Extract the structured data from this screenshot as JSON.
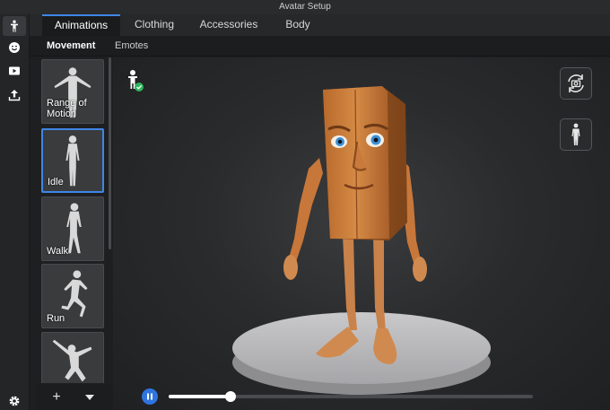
{
  "window": {
    "title": "Avatar Setup"
  },
  "rail": {
    "items": [
      {
        "icon": "person-icon",
        "active": true
      },
      {
        "icon": "smiley-icon",
        "active": false
      },
      {
        "icon": "video-icon",
        "active": false
      },
      {
        "icon": "upload-icon",
        "active": false
      }
    ],
    "settings_icon": "gear-icon"
  },
  "tabs": [
    {
      "label": "Animations",
      "active": true
    },
    {
      "label": "Clothing",
      "active": false
    },
    {
      "label": "Accessories",
      "active": false
    },
    {
      "label": "Body",
      "active": false
    }
  ],
  "subtabs": [
    {
      "label": "Movement",
      "active": true
    },
    {
      "label": "Emotes",
      "active": false
    }
  ],
  "animations": [
    {
      "label": "Range of Motion",
      "selected": false
    },
    {
      "label": "Idle",
      "selected": true
    },
    {
      "label": "Walk",
      "selected": false
    },
    {
      "label": "Run",
      "selected": false
    },
    {
      "label": "",
      "selected": false
    }
  ],
  "bottombar": {
    "add_label": "+",
    "menu_icon": "triangle-down-icon"
  },
  "viewport": {
    "status_icon": "avatar-check-icon",
    "camera_button_icon": "camera-rotate-icon",
    "figure_button_icon": "full-body-icon"
  },
  "playback": {
    "state": "playing",
    "progress": 0.17
  },
  "colors": {
    "accent": "#3f86e6",
    "play": "#2f74e0",
    "check": "#2fb35a"
  }
}
